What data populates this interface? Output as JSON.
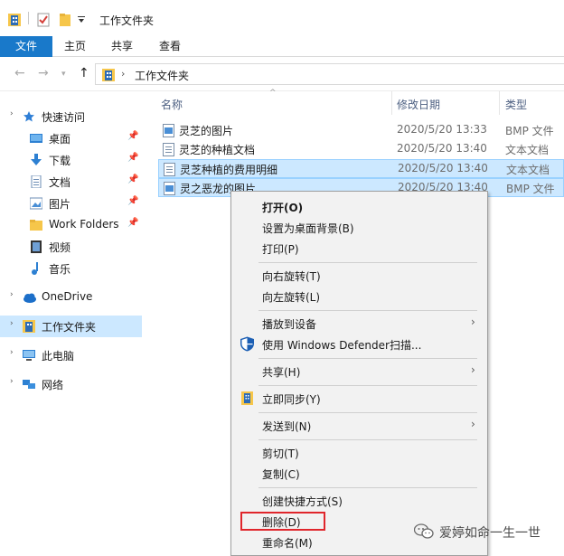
{
  "window": {
    "title": "工作文件夹"
  },
  "ribbon": {
    "tabs": [
      {
        "label": "文件",
        "active": true
      },
      {
        "label": "主页",
        "active": false
      },
      {
        "label": "共享",
        "active": false
      },
      {
        "label": "查看",
        "active": false
      }
    ]
  },
  "address": {
    "path": "工作文件夹",
    "separator": "›"
  },
  "nav": {
    "items": [
      {
        "label": "快速访问",
        "icon": "star-icon",
        "pinned": false
      },
      {
        "label": "桌面",
        "icon": "desktop-icon",
        "pinned": true
      },
      {
        "label": "下载",
        "icon": "download-icon",
        "pinned": true
      },
      {
        "label": "文档",
        "icon": "document-icon",
        "pinned": true
      },
      {
        "label": "图片",
        "icon": "picture-icon",
        "pinned": true
      },
      {
        "label": "Work Folders",
        "icon": "folder-icon",
        "pinned": true
      },
      {
        "label": "视频",
        "icon": "video-icon",
        "pinned": false
      },
      {
        "label": "音乐",
        "icon": "music-icon",
        "pinned": false
      },
      {
        "label": "OneDrive",
        "icon": "cloud-icon",
        "pinned": false
      },
      {
        "label": "工作文件夹",
        "icon": "work-folder-icon",
        "pinned": false,
        "selected": true
      },
      {
        "label": "此电脑",
        "icon": "computer-icon",
        "pinned": false
      },
      {
        "label": "网络",
        "icon": "network-icon",
        "pinned": false
      }
    ]
  },
  "list": {
    "columns": {
      "name": "名称",
      "date": "修改日期",
      "type": "类型"
    },
    "rows": [
      {
        "name": "灵芝的图片",
        "date": "2020/5/20 13:33",
        "type": "BMP 文件",
        "icon": "image-file-icon",
        "selected": false
      },
      {
        "name": "灵芝的种植文档",
        "date": "2020/5/20 13:40",
        "type": "文本文档",
        "icon": "text-file-icon",
        "selected": false
      },
      {
        "name": "灵芝种植的费用明细",
        "date": "2020/5/20 13:40",
        "type": "文本文档",
        "icon": "text-file-icon",
        "selected": true
      },
      {
        "name": "灵之恶龙的图片",
        "date": "2020/5/20 13:40",
        "type": "BMP 文件",
        "icon": "image-file-icon",
        "selected": true
      }
    ]
  },
  "context_menu": {
    "items": [
      {
        "label": "打开(O)",
        "bold": true
      },
      {
        "label": "设置为桌面背景(B)"
      },
      {
        "label": "打印(P)"
      },
      {
        "label": "向右旋转(T)"
      },
      {
        "label": "向左旋转(L)"
      },
      {
        "label": "播放到设备",
        "submenu": true
      },
      {
        "label": "使用 Windows Defender扫描...",
        "icon": "defender-shield-icon"
      },
      {
        "label": "共享(H)",
        "submenu": true
      },
      {
        "label": "立即同步(Y)",
        "icon": "sync-folder-icon"
      },
      {
        "label": "发送到(N)",
        "submenu": true
      },
      {
        "label": "剪切(T)"
      },
      {
        "label": "复制(C)"
      },
      {
        "label": "创建快捷方式(S)"
      },
      {
        "label": "删除(D)",
        "highlighted": true
      },
      {
        "label": "重命名(M)"
      }
    ],
    "highlight_color": "#e0262c"
  },
  "watermark": {
    "text": "爱婷如命一生一世"
  },
  "colors": {
    "accent": "#1979ca",
    "selection": "#cce8ff",
    "selection_border": "#99d1ff"
  }
}
